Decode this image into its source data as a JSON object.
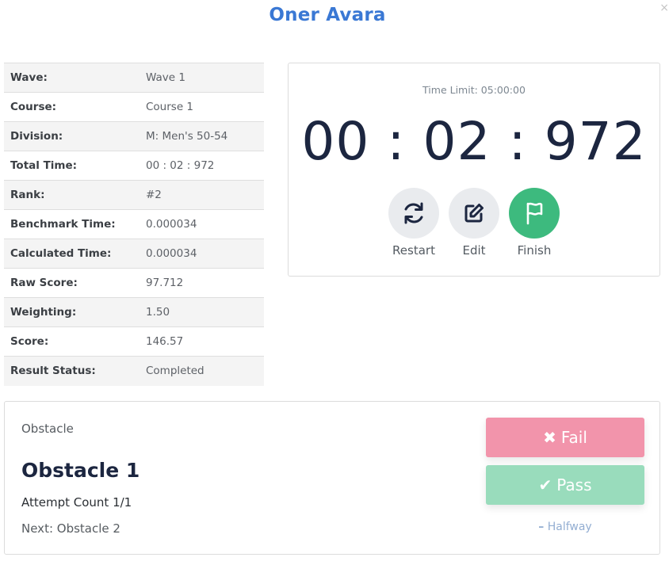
{
  "header": {
    "title": "Oner Avara",
    "close_symbol": "×"
  },
  "info": [
    {
      "label": "Wave:",
      "value": "Wave 1"
    },
    {
      "label": "Course:",
      "value": "Course 1"
    },
    {
      "label": "Division:",
      "value": "M: Men's 50-54"
    },
    {
      "label": "Total Time:",
      "value": "00 : 02 : 972"
    },
    {
      "label": "Rank:",
      "value": "#2"
    },
    {
      "label": "Benchmark Time:",
      "value": "0.000034"
    },
    {
      "label": "Calculated Time:",
      "value": "0.000034"
    },
    {
      "label": "Raw Score:",
      "value": "97.712"
    },
    {
      "label": "Weighting:",
      "value": "1.50"
    },
    {
      "label": "Score:",
      "value": "146.57"
    },
    {
      "label": "Result Status:",
      "value": "Completed"
    }
  ],
  "timer": {
    "time_limit": "Time Limit: 05:00:00",
    "clock": "00 : 02 : 972",
    "controls": [
      {
        "label": "Restart",
        "icon": "refresh-icon"
      },
      {
        "label": "Edit",
        "icon": "edit-icon"
      },
      {
        "label": "Finish",
        "icon": "flag-icon"
      }
    ]
  },
  "obstacle": {
    "label": "Obstacle",
    "name": "Obstacle 1",
    "attempt": "Attempt Count 1/1",
    "next": "Next: Obstacle 2",
    "fail_label": "Fail",
    "pass_label": "Pass",
    "halfway_label": "Halfway",
    "fail_icon": "✖",
    "pass_icon": "✔",
    "halfway_icon": "–"
  },
  "colors": {
    "title": "#3a78d4",
    "finish": "#3dba7e",
    "fail": "#f294ab",
    "pass": "#99dcbc",
    "halfway": "#93aed2"
  }
}
